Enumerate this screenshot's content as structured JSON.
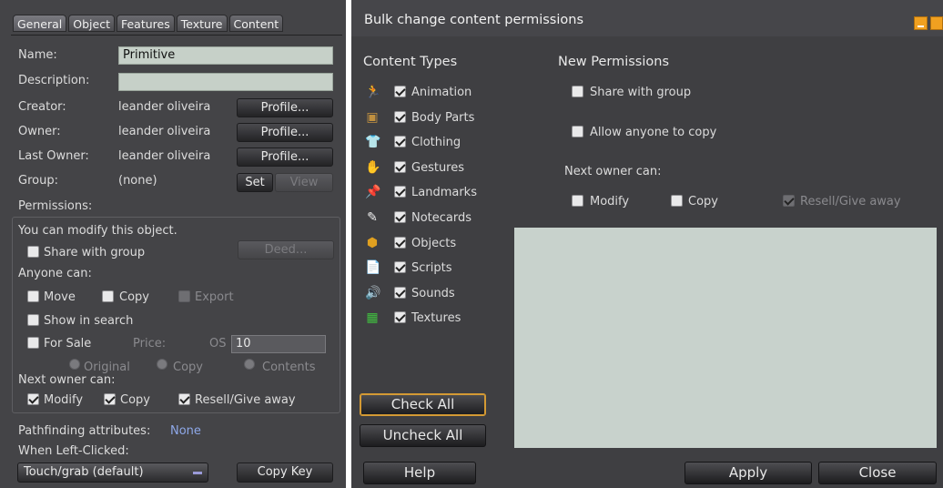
{
  "left": {
    "tabs": [
      "General",
      "Object",
      "Features",
      "Texture",
      "Content"
    ],
    "name_label": "Name:",
    "name_value": "Primitive",
    "description_label": "Description:",
    "description_value": "",
    "creator_label": "Creator:",
    "creator_value": "leander oliveira",
    "owner_label": "Owner:",
    "owner_value": "leander oliveira",
    "last_owner_label": "Last Owner:",
    "last_owner_value": "leander oliveira",
    "profile_label": "Profile...",
    "group_label": "Group:",
    "group_value": "(none)",
    "set_label": "Set",
    "view_label": "View",
    "permissions_label": "Permissions:",
    "modify_note": "You can modify this object.",
    "share_group": "Share with group",
    "deed_label": "Deed...",
    "anyone_can": "Anyone can:",
    "move": "Move",
    "copy": "Copy",
    "export": "Export",
    "show_in_search": "Show in search",
    "for_sale": "For Sale",
    "price_label": "Price:",
    "os_label": "OS",
    "price_value": "10",
    "radio_original": "Original",
    "radio_copy": "Copy",
    "radio_contents": "Contents",
    "next_owner_can": "Next owner can:",
    "next_modify": "Modify",
    "next_copy": "Copy",
    "next_resell": "Resell/Give away",
    "pathfinding_label": "Pathfinding attributes:",
    "pathfinding_value": "None",
    "left_click_label": "When Left-Clicked:",
    "left_click_value": "Touch/grab (default)",
    "copy_key": "Copy Key"
  },
  "right": {
    "title": "Bulk change content permissions",
    "content_types_heading": "Content Types",
    "content_types": [
      {
        "label": "Animation",
        "icon": "running-figure-icon",
        "glyph": "🏃",
        "checked": true
      },
      {
        "label": "Body Parts",
        "icon": "body-parts-icon",
        "glyph": "▣",
        "checked": true
      },
      {
        "label": "Clothing",
        "icon": "shirt-icon",
        "glyph": "👕",
        "checked": true
      },
      {
        "label": "Gestures",
        "icon": "gesture-icon",
        "glyph": "✋",
        "checked": true
      },
      {
        "label": "Landmarks",
        "icon": "pushpin-icon",
        "glyph": "📌",
        "checked": true
      },
      {
        "label": "Notecards",
        "icon": "notecard-icon",
        "glyph": "✎",
        "checked": true
      },
      {
        "label": "Objects",
        "icon": "cube-icon",
        "glyph": "⬢",
        "checked": true
      },
      {
        "label": "Scripts",
        "icon": "script-icon",
        "glyph": "📄",
        "checked": true
      },
      {
        "label": "Sounds",
        "icon": "speaker-icon",
        "glyph": "🔊",
        "checked": true
      },
      {
        "label": "Textures",
        "icon": "texture-icon",
        "glyph": "▦",
        "checked": true
      }
    ],
    "new_permissions_heading": "New Permissions",
    "share_with_group": "Share with group",
    "allow_anyone_copy": "Allow anyone to copy",
    "next_owner_can": "Next owner can:",
    "modify": "Modify",
    "copy": "Copy",
    "resell": "Resell/Give away",
    "check_all": "Check All",
    "uncheck_all": "Uncheck All",
    "help": "Help",
    "apply": "Apply",
    "close": "Close"
  },
  "colors": {
    "panel_bg": "#444447",
    "accent_orange": "#f0a020",
    "field_bg": "#c6d0c8",
    "link_blue": "#8ea8e8"
  }
}
